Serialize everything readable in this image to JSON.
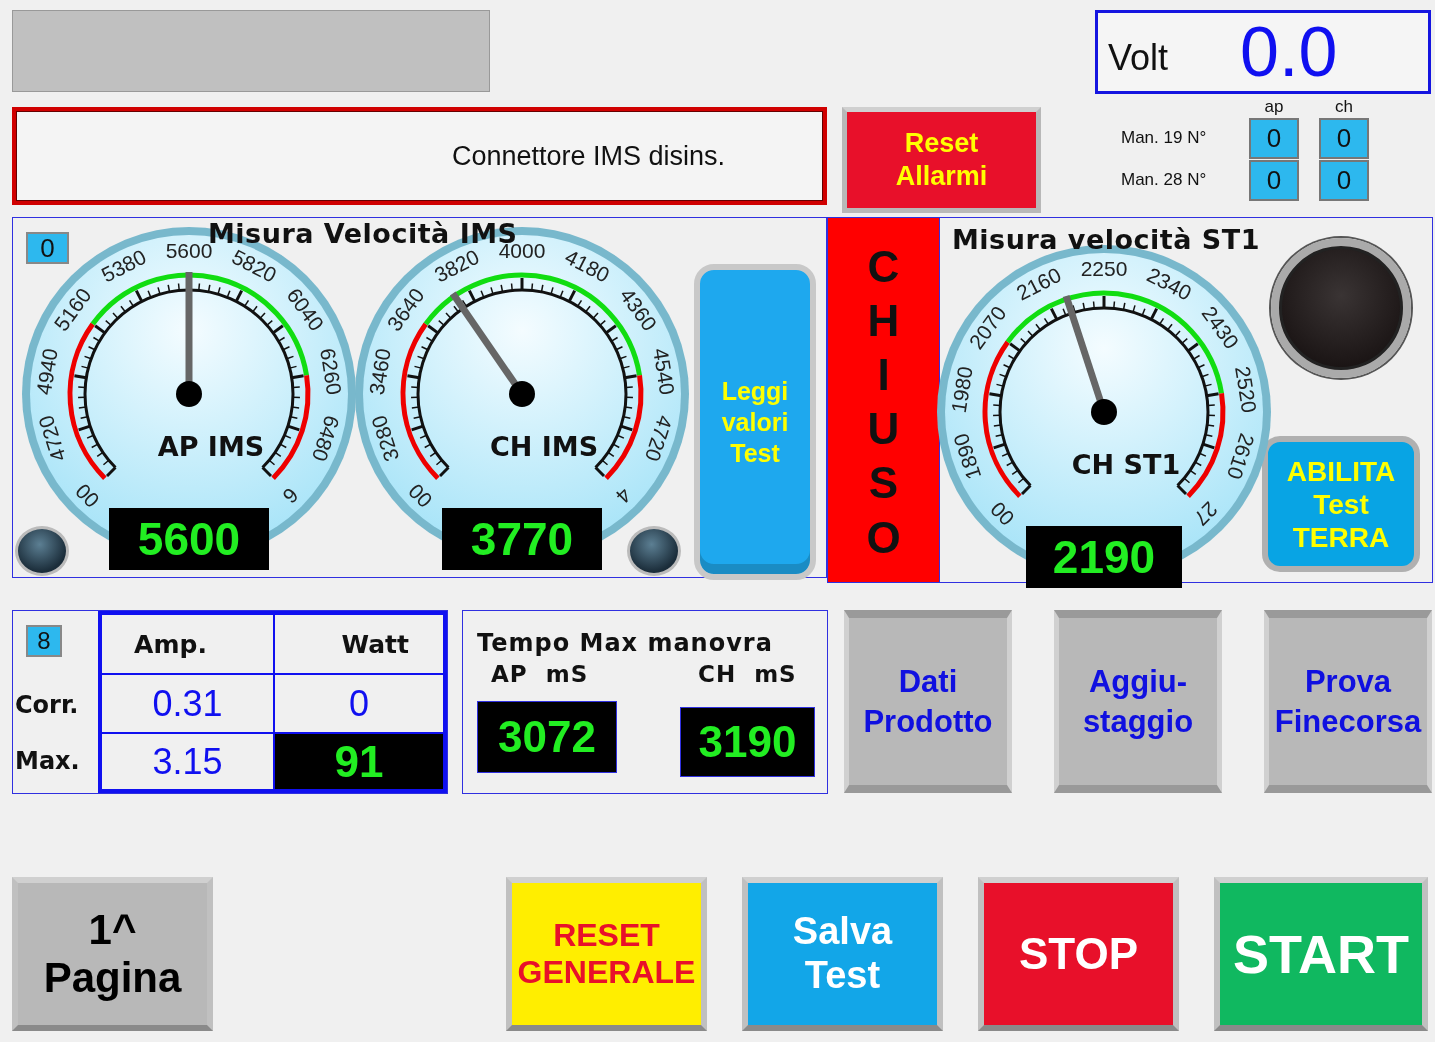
{
  "volt": {
    "label": "Volt",
    "value": "0.0"
  },
  "alarm": {
    "message": "Connettore IMS disins."
  },
  "reset_alarms": {
    "label": "Reset\nAllarmi"
  },
  "counters": {
    "columns": [
      "ap",
      "ch"
    ],
    "rows": [
      {
        "label": "Man. 19 N°",
        "values": [
          "0",
          "0"
        ]
      },
      {
        "label": "Man. 28 N°",
        "values": [
          "0",
          "0"
        ]
      }
    ]
  },
  "ims_panel": {
    "badge": "0",
    "title": "Misura Velocità IMS",
    "gauges": [
      {
        "name": "AP IMS",
        "scale": [
          "00",
          "4720",
          "4940",
          "5160",
          "5380",
          "5600",
          "5820",
          "6040",
          "6260",
          "6480",
          "6"
        ],
        "level": 0.5,
        "reading": "5600"
      },
      {
        "name": "CH IMS",
        "scale": [
          "00",
          "3280",
          "3460",
          "3640",
          "3820",
          "4000",
          "4180",
          "4360",
          "4540",
          "4720",
          "4"
        ],
        "level": 0.372,
        "reading": "3770"
      }
    ],
    "read_button": {
      "label": "Leggi\nvalori\nTest"
    }
  },
  "st1_panel": {
    "status": "CHIUSO",
    "title": "Misura velocità ST1",
    "gauge": {
      "name": "CH ST1",
      "scale": [
        "00",
        "1890",
        "1980",
        "2070",
        "2160",
        "2250",
        "2340",
        "2430",
        "2520",
        "2610",
        "27"
      ],
      "level": 0.433,
      "reading": "2190"
    },
    "enable_button": {
      "label": "ABILITA\nTest\nTERRA"
    }
  },
  "power": {
    "badge": "8",
    "row_labels": [
      "Corr.",
      "Max."
    ],
    "columns": [
      "Amp.",
      "Watt"
    ],
    "rows": [
      [
        {
          "text": "0.31",
          "highlighted": false
        },
        {
          "text": "0",
          "highlighted": false
        }
      ],
      [
        {
          "text": "3.15",
          "highlighted": false
        },
        {
          "text": "91",
          "highlighted": true
        }
      ]
    ]
  },
  "tempo": {
    "title": "Tempo Max manovra",
    "items": [
      {
        "label": "AP  mS",
        "value": "3072"
      },
      {
        "label": "CH  mS",
        "value": "3190"
      }
    ]
  },
  "side_buttons": [
    "Dati\nProdotto",
    "Aggiu-\nstaggio",
    "Prova\nFinecorsa"
  ],
  "footer_buttons": [
    {
      "label": "1^\nPagina",
      "kind": "page"
    },
    {
      "label": "RESET\nGENERALE",
      "kind": "reset"
    },
    {
      "label": "Salva\nTest",
      "kind": "save"
    },
    {
      "label": "STOP",
      "kind": "stop"
    },
    {
      "label": "START",
      "kind": "start"
    }
  ]
}
